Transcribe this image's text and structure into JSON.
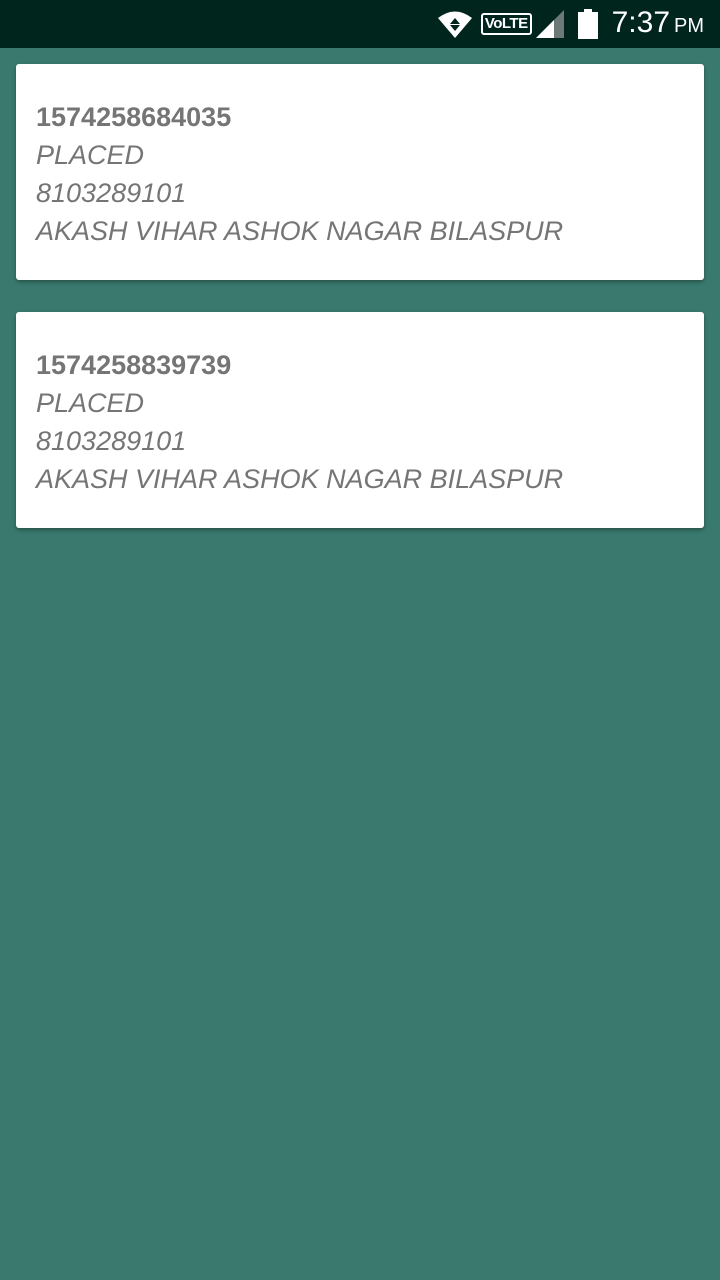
{
  "status_bar": {
    "network_label": "VoLTE",
    "time": "7:37",
    "ampm": "PM",
    "icons": [
      "wifi-icon",
      "volte-icon",
      "signal-icon",
      "battery-icon"
    ],
    "background": "#00251d"
  },
  "theme": {
    "background": "#3a7a6e",
    "card": "#ffffff",
    "text": "#757575"
  },
  "orders": [
    {
      "id": "1574258684035",
      "status": "PLACED",
      "phone": "8103289101",
      "address": "AKASH VIHAR ASHOK NAGAR BILASPUR"
    },
    {
      "id": "1574258839739",
      "status": "PLACED",
      "phone": "8103289101",
      "address": "AKASH VIHAR ASHOK NAGAR BILASPUR"
    }
  ]
}
